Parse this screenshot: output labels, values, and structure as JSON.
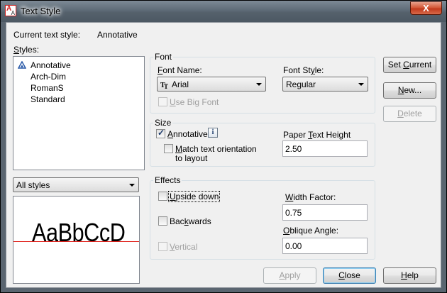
{
  "window": {
    "title": "Text Style",
    "close_glyph": "X",
    "app_icon_letters": [
      "A",
      "A"
    ]
  },
  "current_style": {
    "label": "Current text style:",
    "value": "Annotative"
  },
  "styles": {
    "label": "Styles:",
    "items": [
      {
        "label": "Annotative",
        "annotative": true,
        "selected": true
      },
      {
        "label": "Arch-Dim"
      },
      {
        "label": "RomanS"
      },
      {
        "label": "Standard"
      }
    ],
    "filter_value": "All styles"
  },
  "preview": {
    "sample_text": "AaBbCcD"
  },
  "font": {
    "group_label": "Font",
    "name_label": "Font Name:",
    "name_value": "Arial",
    "style_label": "Font Style:",
    "style_value": "Regular",
    "big_font_label": "Use Big Font",
    "big_font_checked": false
  },
  "size": {
    "group_label": "Size",
    "annotative_label": "Annotative",
    "annotative_checked": true,
    "match_label_line1": "Match text orientation",
    "match_label_line2": "to layout",
    "match_checked": false,
    "height_label": "Paper Text Height",
    "height_value": "2.50"
  },
  "effects": {
    "group_label": "Effects",
    "upside_down_label": "Upside down",
    "backwards_label": "Backwards",
    "vertical_label": "Vertical",
    "width_factor_label": "Width Factor:",
    "width_factor_value": "0.75",
    "oblique_label": "Oblique Angle:",
    "oblique_value": "0.00"
  },
  "buttons": {
    "set_current": "Set Current",
    "new": "New...",
    "delete": "Delete",
    "apply": "Apply",
    "close": "Close",
    "help": "Help"
  },
  "colors": {
    "baseline": "#e0201a",
    "title_bar": "#5e6b77",
    "close_button": "#c23a1c"
  }
}
